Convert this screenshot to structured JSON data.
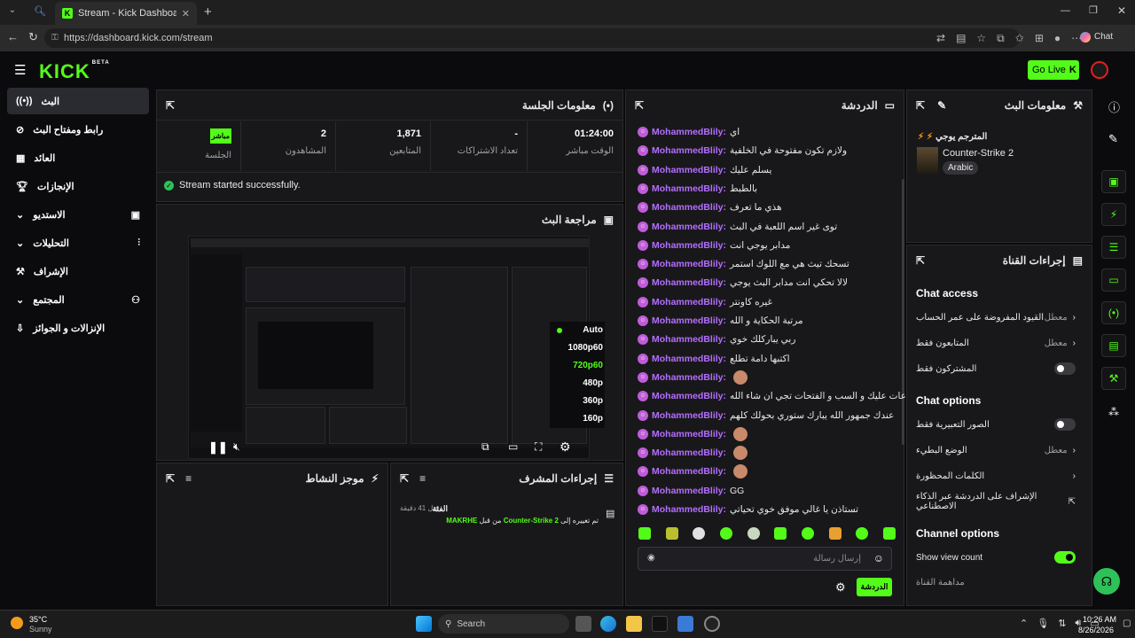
{
  "browser": {
    "tab_title": "Stream - Kick Dashboard",
    "url": "https://dashboard.kick.com/stream",
    "copilot_label": "Chat"
  },
  "header": {
    "logo": "KICK",
    "logo_beta": "BETA",
    "go_live": "Go Live"
  },
  "sidebar": {
    "items": [
      {
        "label": "البث",
        "icon": "broadcast-icon"
      },
      {
        "label": "رابط ومفتاح البث",
        "icon": "link-icon"
      },
      {
        "label": "العائد",
        "icon": "revenue-icon"
      },
      {
        "label": "الإنجازات",
        "icon": "trophy-icon"
      },
      {
        "label": "الاستديو",
        "icon": "studio-icon"
      },
      {
        "label": "التحليلات",
        "icon": "analytics-icon"
      },
      {
        "label": "الإشراف",
        "icon": "moderation-icon"
      },
      {
        "label": "المجتمع",
        "icon": "community-icon"
      },
      {
        "label": "الإنزالات و الجوائز",
        "icon": "drops-icon"
      }
    ]
  },
  "session": {
    "title": "معلومات الجلسة",
    "status_badge": "مباشر",
    "status_label": "الجلسة",
    "stats": [
      {
        "value": "2",
        "label": "المشاهدون"
      },
      {
        "value": "1,871",
        "label": "المتابعين"
      },
      {
        "value": "-",
        "label": "تعداد الاشتراكات"
      },
      {
        "value": "01:24:00",
        "label": "الوقت مباشر"
      }
    ],
    "success_msg": "Stream started successfully."
  },
  "preview": {
    "title": "مراجعة البث",
    "qualities": [
      "Auto",
      "1080p60",
      "720p60",
      "480p",
      "360p",
      "160p"
    ],
    "selected_quality": "720p60"
  },
  "activity": {
    "title": "موجز النشاط"
  },
  "mod_actions": {
    "title": "إجراءات المشرف",
    "time": "قبل 41 دقيقة",
    "entry_title": "الفئة",
    "entry_user": "MAKRHE",
    "entry_from": "من قبل",
    "entry_game": "Counter-Strike 2",
    "entry_text": "تم تغييره إلى"
  },
  "chat": {
    "title": "الدردشة",
    "username": "MohammedBlily:",
    "messages": [
      "اي",
      "ولازم تكون مفتوحة في الخلفية",
      "يسلم عليك",
      "بالطبط",
      "هذي ما تعرف",
      "توى غير اسم اللعبة في البث",
      "مدابر يوجي انت",
      "تسحك تيث هي مع اللوك استمر",
      "لالا تحكي انت مدابر البث يوجي",
      "غيره كاونتر",
      "مرتبة الحكاية و الله",
      "ربي يباركلك خوي",
      "اكتبها دامة تطلع",
      "",
      "الساعات عليك و السب و الفتحات تجي ان شاء الله",
      "عندك جمهور الله يبارك ستوري بحولك كلهم",
      "",
      "",
      "",
      "GG",
      "تستاذن يا غالي موفق خوي تحياتي"
    ],
    "input_placeholder": "إرسال رسالة",
    "send_label": "الدردشة"
  },
  "stream_info": {
    "title": "معلومات البث",
    "stream_title": "المترجم يوجي",
    "game": "Counter-Strike 2",
    "language": "Arabic"
  },
  "channel_actions": {
    "title": "إجراءات القناة",
    "chat_access": "Chat access",
    "rows_access": [
      {
        "label": "القيود المفروضة على عمر الحساب",
        "value": "معطل",
        "type": "chevron"
      },
      {
        "label": "المتابعون فقط",
        "value": "معطل",
        "type": "chevron"
      },
      {
        "label": "المشتركون فقط",
        "value": "",
        "type": "toggle-off"
      }
    ],
    "chat_options": "Chat options",
    "rows_options": [
      {
        "label": "الصور التعبيرية فقط",
        "value": "",
        "type": "toggle-off"
      },
      {
        "label": "الوضع البطيء",
        "value": "معطل",
        "type": "chevron"
      },
      {
        "label": "الكلمات المحظورة",
        "value": "",
        "type": "chevron"
      },
      {
        "label": "الإشراف على الدردشة عبر الذكاء الاصطناعي",
        "value": "",
        "type": "external"
      }
    ],
    "channel_options": "Channel options",
    "show_view_count": "Show view count",
    "channel_watch": "مداهمة القناة"
  },
  "taskbar": {
    "temp": "35°C",
    "weather": "Sunny",
    "search": "Search",
    "time": "10:26 AM",
    "date": "8/26/2026"
  },
  "colors": {
    "accent": "#53fc18",
    "username": "#b56eff",
    "panel": "#18181b"
  }
}
